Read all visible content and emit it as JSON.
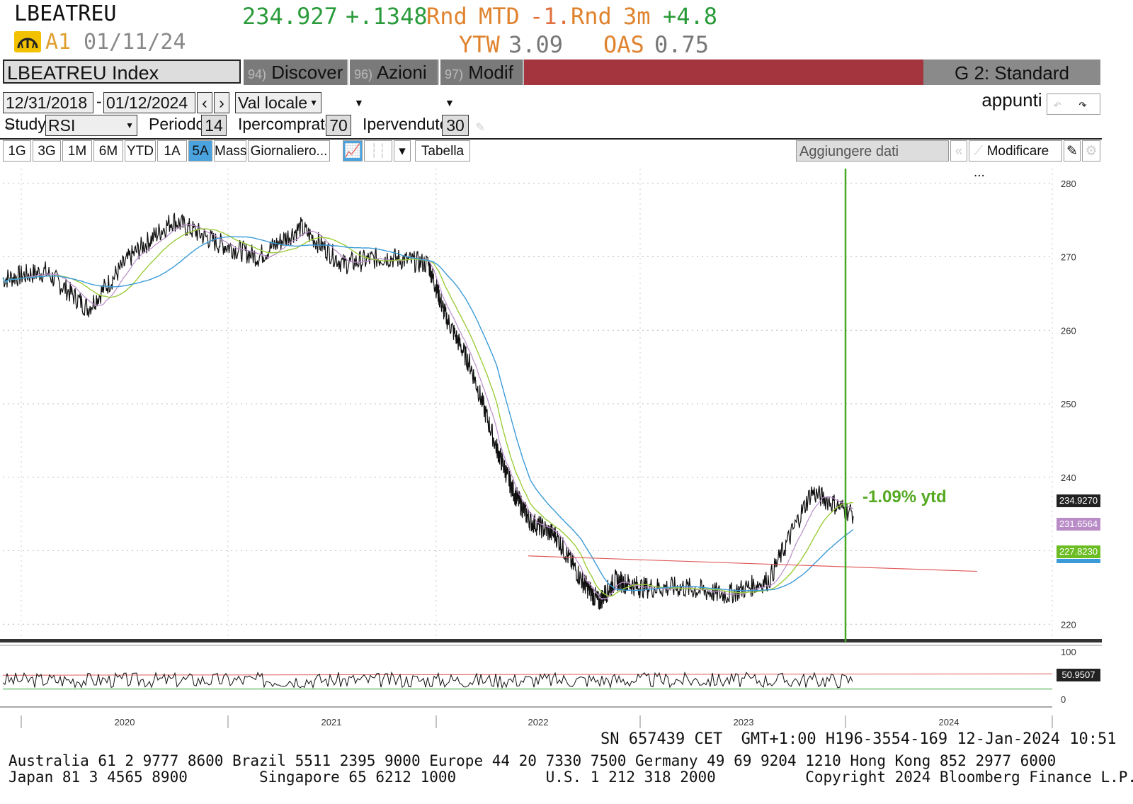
{
  "header": {
    "ticker": "LBEATREU",
    "last": "234.927",
    "change": "+.1348",
    "rnd1": "Rnd",
    "mtd_label": "MTD",
    "mtd_value": "-1.",
    "rnd2": "Rnd",
    "m3_label": "3m",
    "m3_value": "+4.8",
    "rating": "A1",
    "date": "01/11/24",
    "ytw_label": "YTW",
    "ytw_value": "3.09",
    "oas_label": "OAS",
    "oas_value": "0.75"
  },
  "toolbar": {
    "security": "LBEATREU Index",
    "menu": [
      {
        "num": "94)",
        "label": "Discover"
      },
      {
        "num": "96)",
        "label": "Azioni"
      },
      {
        "num": "97)",
        "label": "Modif"
      }
    ],
    "template": "G 2: Standard appunti"
  },
  "range": {
    "start": "12/31/2018",
    "end": "01/12/2024",
    "currency": "Val locale"
  },
  "study": {
    "label": "Study",
    "name": "RSI",
    "period_label": "Periodo",
    "period": "14",
    "overbought_label": "Ipercomprato",
    "overbought": "70",
    "oversold_label": "Ipervenduto",
    "oversold": "30"
  },
  "tabs": [
    "1G",
    "3G",
    "1M",
    "6M",
    "YTD",
    "1A",
    "5A",
    "Mass",
    "Giornaliero..."
  ],
  "active_tab": "5A",
  "table_label": "Tabella",
  "add_data_label": "Aggiungere dati",
  "modify_label": "Modificare ...",
  "annotation": "-1.09% ytd",
  "price_labels": {
    "last": "234.9270",
    "ma1": "231.6564",
    "ma2": "227.8230",
    "rsi": "50.9507"
  },
  "colors": {
    "price": "#111111",
    "ma_short": "#b98cc8",
    "ma_mid": "#9ccc3a",
    "ma_long": "#3a9bd8",
    "trend": "#e05a5a",
    "marker": "#44aa22",
    "annotation": "#55aa22"
  },
  "chart_data": {
    "type": "line",
    "x_ticks": [
      "2020",
      "2021",
      "2022",
      "2023",
      "2024"
    ],
    "ylim": [
      218,
      282
    ],
    "y_ticks": [
      220,
      230,
      240,
      250,
      260,
      270,
      280
    ],
    "rsi_ticks": [
      0,
      100
    ],
    "rsi_levels": [
      30,
      70
    ],
    "series": [
      {
        "t": [
          0,
          0.05,
          0.1,
          0.15,
          0.2,
          0.25,
          0.3,
          0.35,
          0.4,
          0.45,
          0.5,
          0.52,
          0.55,
          0.58,
          0.6,
          0.62,
          0.65,
          0.68,
          0.7,
          0.72,
          0.75,
          0.8,
          0.85,
          0.9,
          0.95,
          1.0
        ],
        "values": [
          267,
          268,
          263,
          270,
          275,
          272,
          270,
          274,
          269,
          270,
          269,
          262,
          255,
          244,
          238,
          234,
          232,
          226,
          223,
          226,
          225,
          225,
          224,
          226,
          238,
          235
        ]
      }
    ]
  },
  "footer": {
    "sn": "SN 657439 CET  GMT+1:00 H196-3554-169 12-Jan-2024 10:51",
    "line1": "Australia 61 2 9777 8600 Brazil 5511 2395 9000 Europe 44 20 7330 7500 Germany 49 69 9204 1210 Hong Kong 852 2977 6000",
    "line2": "Japan 81 3 4565 8900        Singapore 65 6212 1000          U.S. 1 212 318 2000          Copyright 2024 Bloomberg Finance L.P."
  }
}
